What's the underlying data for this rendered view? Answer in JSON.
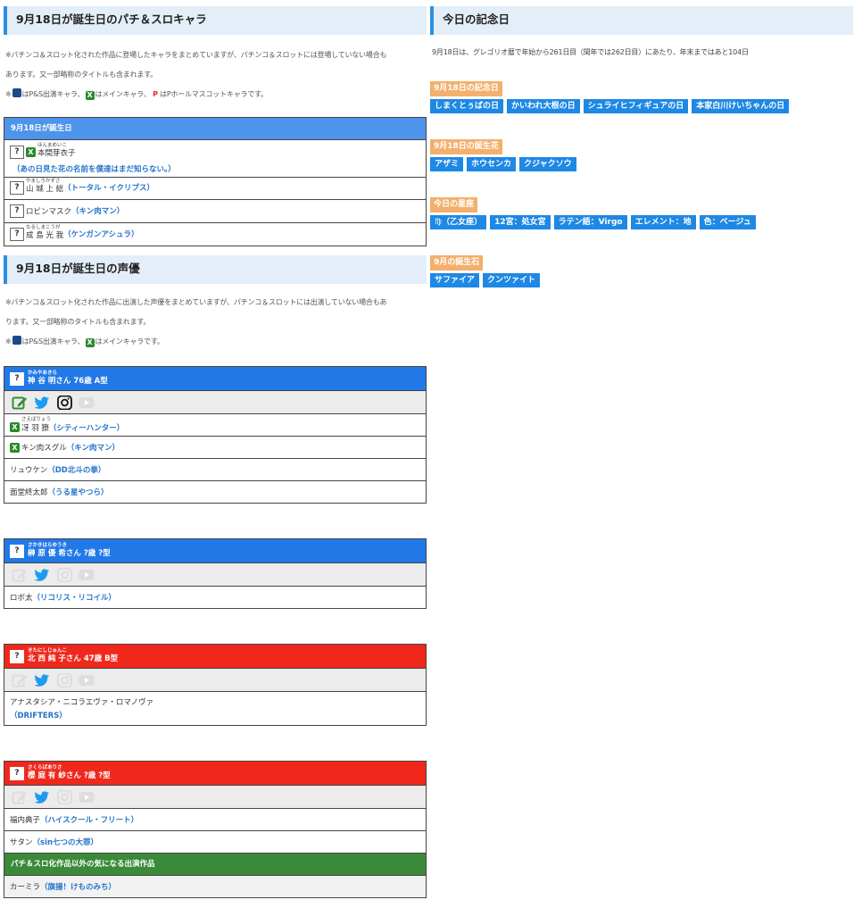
{
  "left": {
    "chara_title": "9月18日が誕生日のパチ＆スロキャラ",
    "chara_notes": [
      "※パチンコ＆スロット化された作品に登場したキャラをまとめていますが、パチンコ＆スロットには登場していない場合も",
      "あります。又一部略称のタイトルも含まれます。"
    ],
    "chara_legend": {
      "a": "※",
      "b": "はP&S出演キャラ、",
      "c": "はメインキャラ、",
      "d": "はPホールマスコットキャラです。",
      "p": "P",
      "x": "X"
    },
    "chara_table": {
      "header": "9月18日が誕生日",
      "q": "?",
      "rows": [
        {
          "ruby": "ほんまめいこ",
          "name": "本間芽衣子",
          "title": "（あの日見た花の名前を僕達はまだ知らない。）"
        },
        {
          "ruby": "やましろかずさ",
          "name": "山 城 上 総",
          "title": "（トータル・イクリプス）"
        },
        {
          "ruby": "",
          "name": "ロビンマスク",
          "title": "（キン肉マン）"
        },
        {
          "ruby": "なるしまこうが",
          "name": "成 島 光 我",
          "title": "（ケンガンアシュラ）"
        }
      ]
    },
    "va_title": "9月18日が誕生日の声優",
    "va_notes": [
      "※パチンコ＆スロット化された作品に出演した声優をまとめていますが、パチンコ＆スロットには出演していない場合もあ",
      "ります。又一部略称のタイトルも含まれます。"
    ],
    "va_legend": {
      "a": "※",
      "b": "はP&S出演キャラ、",
      "c": "はメインキャラです。",
      "x": "X"
    },
    "voice_actors": [
      {
        "ruby": "かみやあきら",
        "name": "神 谷 明さん 76歳 A型",
        "roles": [
          {
            "ruby": "さえばりょう",
            "name": "冴 羽 獠",
            "title": "（シティーハンター）",
            "main": true
          },
          {
            "ruby": "",
            "name": "キン肉スグル",
            "title": "（キン肉マン）",
            "main": true
          },
          {
            "ruby": "",
            "name": "リュウケン",
            "title": "（DD北斗の拳）",
            "main": false
          },
          {
            "ruby": "",
            "name": "面堂終太郎",
            "title": "（うる星やつら）",
            "main": false
          }
        ]
      },
      {
        "ruby": "さかきはらゆうき",
        "name": "榊 原 優 希さん ?歳 ?型",
        "roles": [
          {
            "ruby": "",
            "name": "ロボ太",
            "title": "（リコリス・リコイル）",
            "main": false
          }
        ]
      },
      {
        "ruby": "きたにしじゅんこ",
        "name": "北 西 純 子さん 47歳 B型",
        "roles": [
          {
            "ruby": "",
            "name": "アナスタシア・ニコラエヴァ・ロマノヴァ",
            "title": "（DRIFTERS）",
            "main": false
          }
        ]
      },
      {
        "ruby": "さくらばありさ",
        "name": "櫻 庭 有 紗さん ?歳 ?型",
        "roles": [
          {
            "ruby": "",
            "name": "福内典子",
            "title": "（ハイスクール・フリート）",
            "main": false
          },
          {
            "ruby": "",
            "name": "サタン",
            "title": "（sin七つの大罪）",
            "main": false
          }
        ],
        "other_label": "パチ＆スロ化作品以外の気になる出演作品",
        "other_roles": [
          {
            "name": "カーミラ",
            "title": "（旗揚！けものみち）"
          }
        ]
      }
    ]
  },
  "right": {
    "title": "今日の記念日",
    "note": "9月18日は、グレゴリオ暦で年始から261日目（閏年では262日目）にあたり、年末まではあと104日",
    "groups": [
      {
        "label": "9月18日の記念日",
        "chips": [
          "しまくとぅばの日",
          "かいわれ大根の日",
          "シュライヒフィギュアの日",
          "本家白川けいちゃんの日"
        ]
      },
      {
        "label": "9月18日の誕生花",
        "chips": [
          "アザミ",
          "ホウセンカ",
          "クジャクソウ"
        ]
      },
      {
        "label": "今日の星座",
        "chips": [
          "♍（乙女座）",
          "12宮：処女宮",
          "ラテン語：Virgo",
          "エレメント：地",
          "色：ベージュ"
        ]
      },
      {
        "label": "9月の誕生石",
        "chips": [
          "サファイア",
          "クンツァイト"
        ]
      }
    ]
  },
  "colors": {
    "accent": "#2c8fe0",
    "blue_head": "#2179e8",
    "red_head": "#f0281c",
    "chip": "#1e88e5",
    "label": "#f3b06c",
    "green": "#3a8a3a"
  },
  "icons": [
    "edit-icon",
    "twitter-icon",
    "instagram-icon",
    "youtube-icon"
  ]
}
